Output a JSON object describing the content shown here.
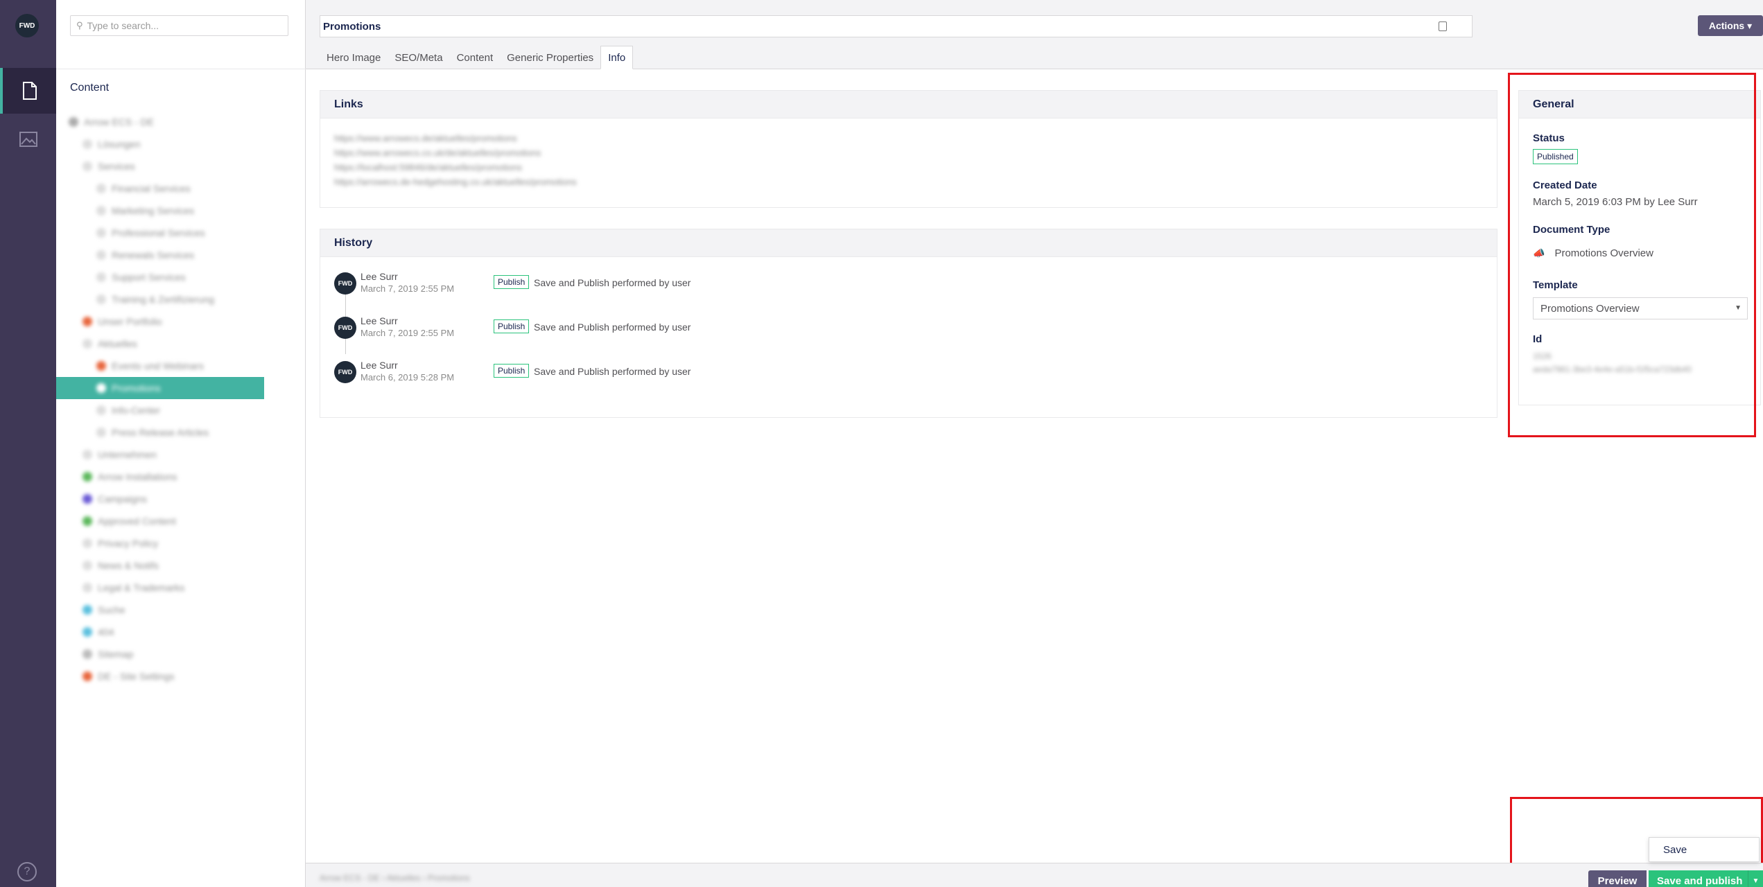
{
  "search": {
    "placeholder": "Type to search..."
  },
  "tree": {
    "section_title": "Content",
    "items": [
      {
        "label": "Arrow ECS - DE",
        "indent": 0
      },
      {
        "label": "Lösungen",
        "indent": 1
      },
      {
        "label": "Services",
        "indent": 1
      },
      {
        "label": "Financial Services",
        "indent": 2
      },
      {
        "label": "Marketing Services",
        "indent": 2
      },
      {
        "label": "Professional Services",
        "indent": 2
      },
      {
        "label": "Renewals Services",
        "indent": 2
      },
      {
        "label": "Support Services",
        "indent": 2
      },
      {
        "label": "Training & Zertifizierung",
        "indent": 2
      },
      {
        "label": "Unser Portfolio",
        "indent": 1
      },
      {
        "label": "Aktuelles",
        "indent": 1
      },
      {
        "label": "Events und Webinars",
        "indent": 2
      },
      {
        "label": "Promotions",
        "indent": 2,
        "selected": true
      },
      {
        "label": "Info-Center",
        "indent": 2
      },
      {
        "label": "Press Release Articles",
        "indent": 2
      },
      {
        "label": "Unternehmen",
        "indent": 1
      },
      {
        "label": "Arrow Installations",
        "indent": 1
      },
      {
        "label": "Campaigns",
        "indent": 1
      },
      {
        "label": "Approved Content",
        "indent": 1
      },
      {
        "label": "Privacy Policy",
        "indent": 1
      },
      {
        "label": "News & Notifs",
        "indent": 1
      },
      {
        "label": "Legal & Trademarks",
        "indent": 1
      },
      {
        "label": "Suche",
        "indent": 1
      },
      {
        "label": "404",
        "indent": 1
      },
      {
        "label": "Sitemap",
        "indent": 1
      },
      {
        "label": "DE - Site Settings",
        "indent": 1
      }
    ]
  },
  "header": {
    "name": "Promotions",
    "actions_label": "Actions ▾",
    "tabs": [
      {
        "label": "Hero Image"
      },
      {
        "label": "SEO/Meta"
      },
      {
        "label": "Content"
      },
      {
        "label": "Generic Properties"
      },
      {
        "label": "Info",
        "active": true
      }
    ]
  },
  "links": {
    "title": "Links",
    "items": [
      "https://www.arrowecs.de/aktuelles/promotions",
      "https://www.arrowecs.co.uk/de/aktuelles/promotions",
      "https://localhost:59846/de/aktuelles/promotions",
      "https://arrowecs.de-hedgehosting.co.uk/aktuelles/promotions"
    ]
  },
  "history": {
    "title": "History",
    "items": [
      {
        "avatar": "FWD",
        "user": "Lee Surr",
        "date": "March 7, 2019 2:55 PM",
        "badge": "Publish",
        "text": "Save and Publish performed by user"
      },
      {
        "avatar": "FWD",
        "user": "Lee Surr",
        "date": "March 7, 2019 2:55 PM",
        "badge": "Publish",
        "text": "Save and Publish performed by user"
      },
      {
        "avatar": "FWD",
        "user": "Lee Surr",
        "date": "March 6, 2019 5:28 PM",
        "badge": "Publish",
        "text": "Save and Publish performed by user"
      }
    ]
  },
  "general": {
    "title": "General",
    "status_label": "Status",
    "status_value": "Published",
    "created_label": "Created Date",
    "created_value": "March 5, 2019 6:03 PM by Lee Surr",
    "doctype_label": "Document Type",
    "doctype_value": "Promotions Overview",
    "template_label": "Template",
    "template_value": "Promotions Overview",
    "id_label": "Id",
    "id_value": "1526",
    "guid_value": "aeda7981-3be3-4e4e-a51b-f1f5ca723db40"
  },
  "footer": {
    "breadcrumb": "Arrow ECS - DE  ›  Aktuelles  ›  Promotions",
    "preview_label": "Preview",
    "save_publish_label": "Save and publish",
    "save_label": "Save"
  },
  "rail": {
    "logo": "FWD",
    "help": "?"
  },
  "colors": {
    "rail": "#3f3856",
    "accent": "#43b3a2",
    "publish": "#2bc37c",
    "action": "#5c5678",
    "highlight": "#e4141b"
  }
}
